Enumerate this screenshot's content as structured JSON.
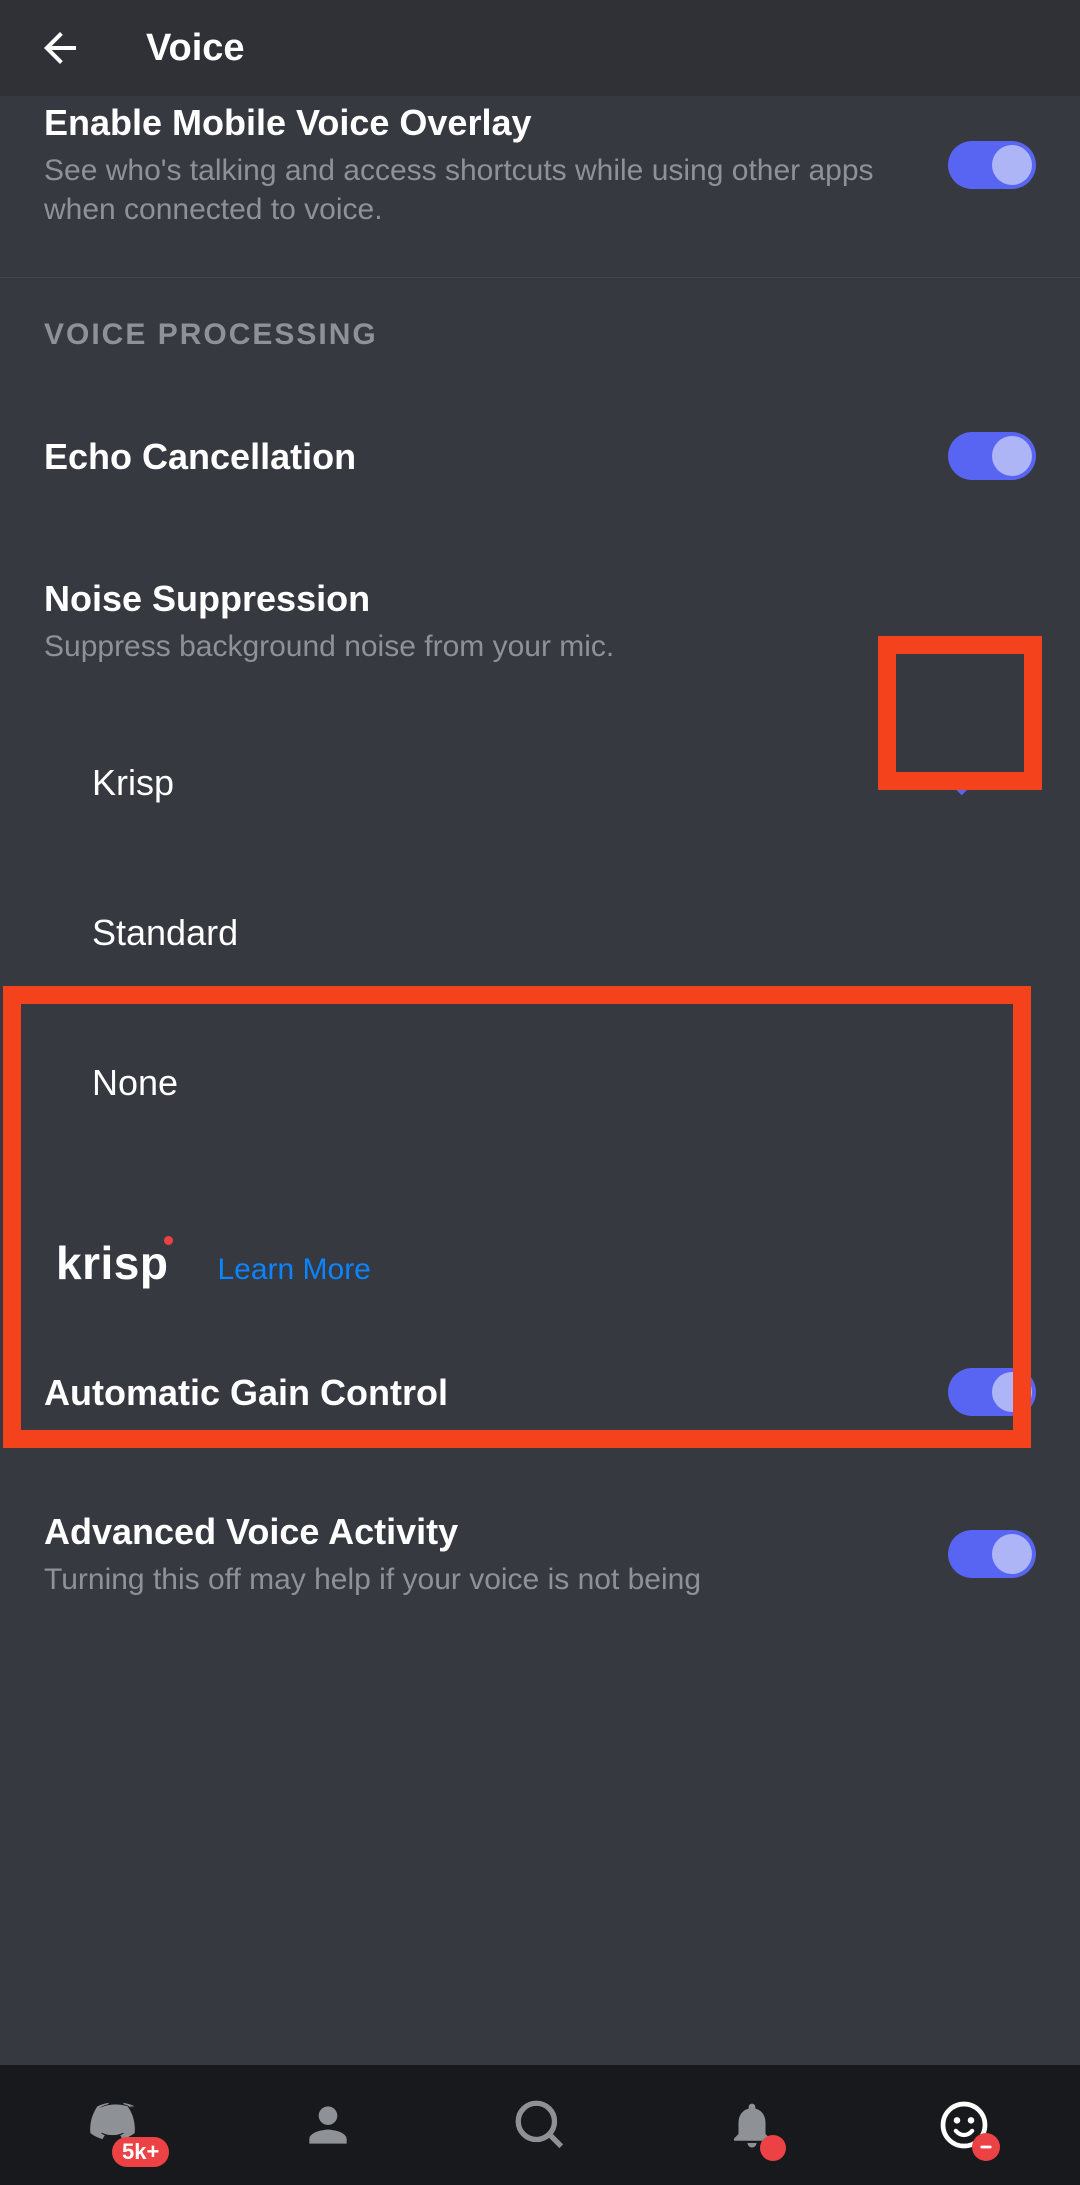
{
  "header": {
    "title": "Voice"
  },
  "overlay": {
    "title": "Enable Mobile Voice Overlay",
    "desc": "See who's talking and access shortcuts while using other apps when connected to voice.",
    "enabled": true
  },
  "sectionVoiceProcessing": "VOICE PROCESSING",
  "echo": {
    "title": "Echo Cancellation",
    "enabled": true
  },
  "noise": {
    "title": "Noise Suppression",
    "desc": "Suppress background noise from your mic.",
    "options": {
      "krisp": "Krisp",
      "standard": "Standard",
      "none": "None"
    },
    "selected": "krisp"
  },
  "krispBrand": {
    "logo": "krisp",
    "learnMore": "Learn More"
  },
  "agc": {
    "title": "Automatic Gain Control",
    "enabled": true
  },
  "advanced": {
    "title": "Advanced Voice Activity",
    "desc": "Turning this off may help if your voice is not being",
    "enabled": true
  },
  "nav": {
    "badge": "5k+"
  }
}
